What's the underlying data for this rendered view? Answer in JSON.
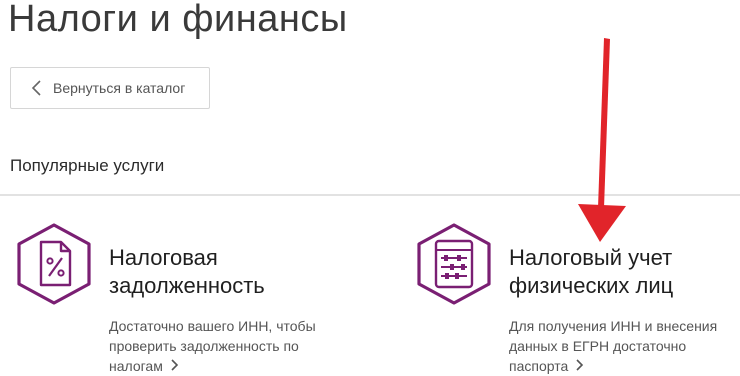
{
  "header": {
    "title": "Налоги и финансы"
  },
  "back": {
    "label": "Вернуться в каталог"
  },
  "section": {
    "title": "Популярные услуги"
  },
  "colors": {
    "accent": "#7a1f73",
    "arrow": "#e1242a",
    "divider": "#e2e2e2"
  },
  "services": [
    {
      "icon": "percent-document-icon",
      "title_line1": "Налоговая",
      "title_line2": "задолженность",
      "desc_line1": "Достаточно вашего ИНН, чтобы",
      "desc_line2": "проверить задолженность по",
      "desc_line3": "налогам"
    },
    {
      "icon": "abacus-icon",
      "title_line1": "Налоговый учет",
      "title_line2": "физических лиц",
      "desc_line1": "Для получения ИНН и внесения",
      "desc_line2": "данных в ЕГРН достаточно",
      "desc_line3": "паспорта"
    }
  ]
}
